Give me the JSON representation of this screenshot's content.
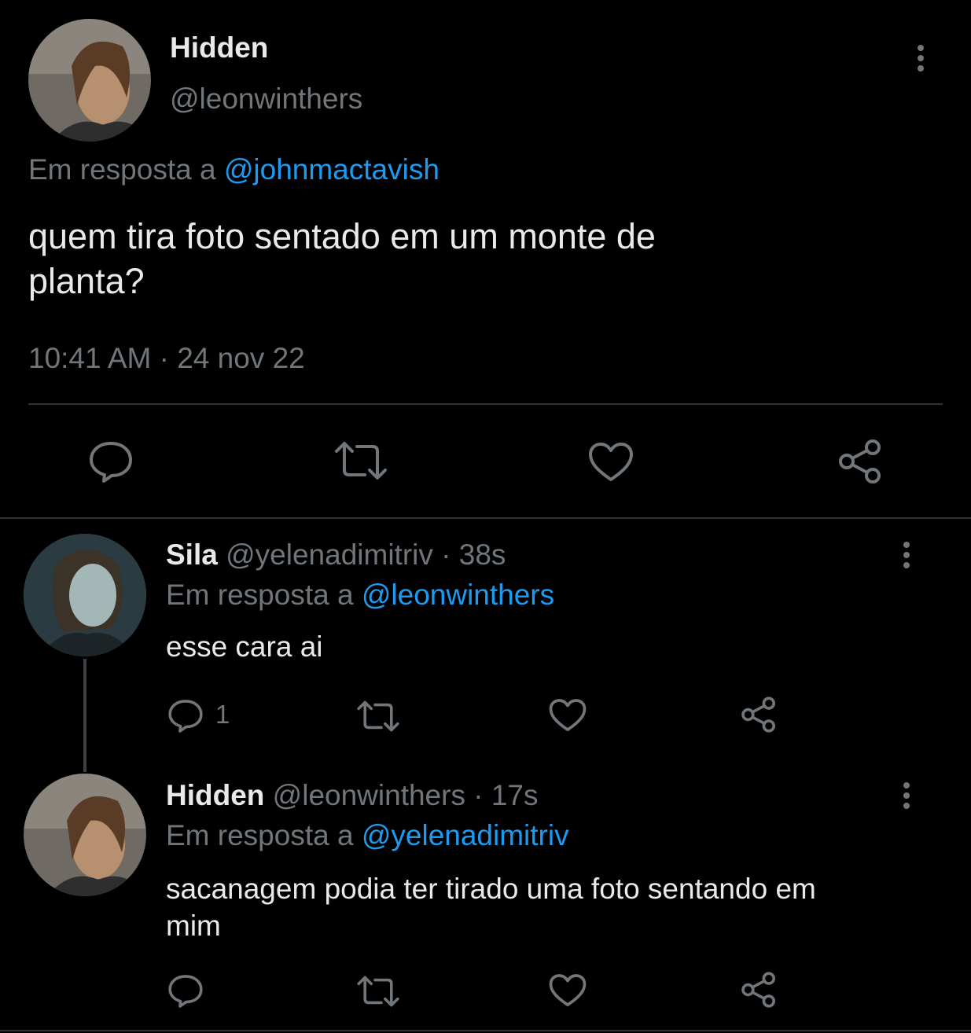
{
  "main_tweet": {
    "display_name": "Hidden",
    "handle": "@leonwinthers",
    "reply_prefix": "Em resposta a",
    "reply_to": "@johnmactavish",
    "text_line1": "quem tira foto sentado em um monte de",
    "text_line2": "planta?",
    "time": "10:41 AM",
    "separator": "·",
    "date": "24 nov 22"
  },
  "replies": [
    {
      "display_name": "Sila",
      "handle": "@yelenadimitriv",
      "age": "· 38s",
      "reply_prefix": "Em resposta a",
      "reply_to": "@leonwinthers",
      "text": "esse cara ai",
      "reply_count": "1"
    },
    {
      "display_name": "Hidden",
      "handle": "@leonwinthers",
      "age": "· 17s",
      "reply_prefix": "Em resposta a",
      "reply_to": "@yelenadimitriv",
      "text_line1": "sacanagem podia ter tirado uma foto sentando em",
      "text_line2": "mim"
    }
  ],
  "icons": [
    "reply-icon",
    "retweet-icon",
    "like-icon",
    "share-icon",
    "more-icon"
  ],
  "colors": {
    "background": "#000000",
    "text": "#e7e9ea",
    "muted": "#71767b",
    "link": "#1d9bf0",
    "divider": "#2f3336"
  }
}
